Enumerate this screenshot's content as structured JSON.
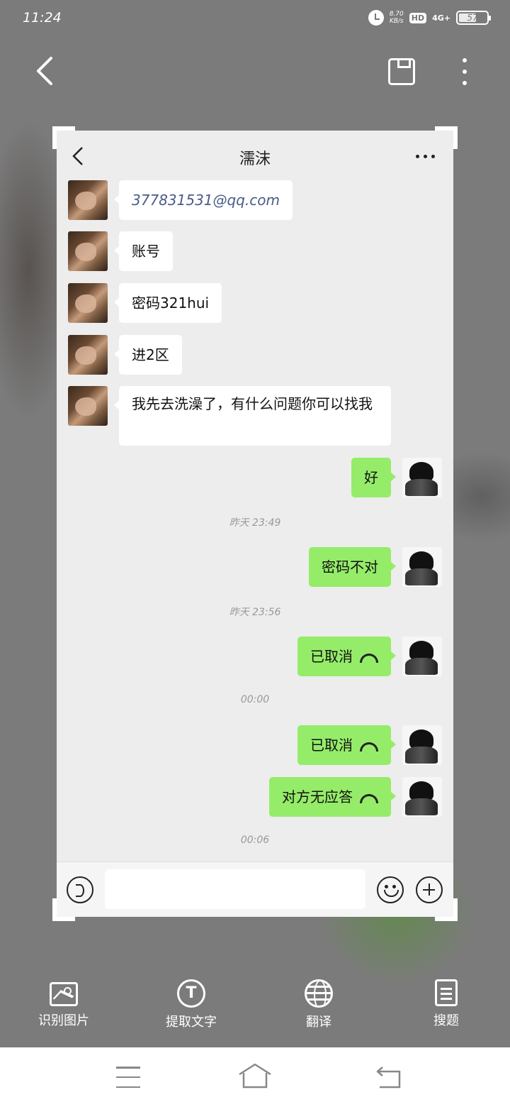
{
  "status_bar": {
    "time": "11:24",
    "net_speed_value": "8.70",
    "net_speed_unit": "KB/s",
    "hd": "HD",
    "network": "4G+",
    "battery": "57"
  },
  "chat": {
    "title": "濡沫",
    "messages": [
      {
        "side": "in",
        "text": "377831531@qq.com"
      },
      {
        "side": "in",
        "text": "账号"
      },
      {
        "side": "in",
        "text": "密码321hui"
      },
      {
        "side": "in",
        "text": "进2区"
      },
      {
        "side": "in",
        "text": "我先去洗澡了，有什么问题你可以找我"
      },
      {
        "side": "out",
        "text": "好"
      },
      {
        "side": "out",
        "text": "密码不对"
      },
      {
        "side": "out",
        "text": "已取消"
      },
      {
        "side": "out",
        "text": "已取消"
      },
      {
        "side": "out",
        "text": "对方无应答"
      }
    ],
    "timestamps": [
      "昨天 23:49",
      "昨天 23:56",
      "00:00",
      "00:06"
    ],
    "input_placeholder": ""
  },
  "tools": [
    {
      "label": "识别图片",
      "icon": "image-recognize-icon"
    },
    {
      "label": "提取文字",
      "icon": "extract-text-icon"
    },
    {
      "label": "翻译",
      "icon": "translate-globe-icon"
    },
    {
      "label": "搜题",
      "icon": "search-question-icon"
    }
  ],
  "icons": {
    "back": "back-arrow-icon",
    "save": "save-icon",
    "more": "more-vertical-icon",
    "nav_menu": "menu-icon",
    "nav_home": "home-icon",
    "nav_back": "return-icon"
  },
  "colors": {
    "out_bubble": "#95ec69",
    "in_bubble": "#ffffff",
    "chat_bg": "#ededed"
  }
}
